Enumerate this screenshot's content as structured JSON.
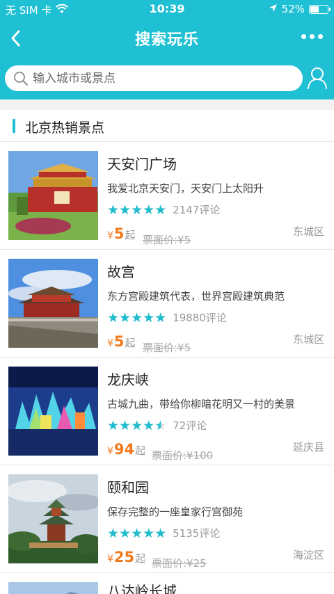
{
  "status_bar": {
    "carrier": "无 SIM 卡",
    "time": "10:39",
    "battery_percent": "52%",
    "battery_level": 0.52
  },
  "nav": {
    "title": "搜索玩乐"
  },
  "search": {
    "placeholder": "输入城市或景点"
  },
  "section": {
    "title": "北京热销景点"
  },
  "colors": {
    "accent": "#1fc0d3",
    "price": "#f27a1e",
    "star": "#1fbccd"
  },
  "attractions": [
    {
      "name": "天安门广场",
      "desc": "我爱北京天安门，天安门上太阳升",
      "rating": 5,
      "reviews": "2147评论",
      "price_symbol": "¥",
      "price": "5",
      "price_suffix": "起",
      "original": "票面价:¥5",
      "district": "东城区"
    },
    {
      "name": "故宫",
      "desc": "东方宫殿建筑代表，世界宫殿建筑典范",
      "rating": 5,
      "reviews": "19880评论",
      "price_symbol": "¥",
      "price": "5",
      "price_suffix": "起",
      "original": "票面价:¥5",
      "district": "东城区"
    },
    {
      "name": "龙庆峡",
      "desc": "古城九曲，带给你柳暗花明又一村的美景",
      "rating": 4.5,
      "reviews": "72评论",
      "price_symbol": "¥",
      "price": "94",
      "price_suffix": "起",
      "original": "票面价:¥100",
      "district": "延庆县"
    },
    {
      "name": "颐和园",
      "desc": "保存完整的一座皇家行宫御苑",
      "rating": 5,
      "reviews": "5135评论",
      "price_symbol": "¥",
      "price": "25",
      "price_suffix": "起",
      "original": "票面价:¥25",
      "district": "海淀区"
    },
    {
      "name": "八达岭长城"
    }
  ]
}
